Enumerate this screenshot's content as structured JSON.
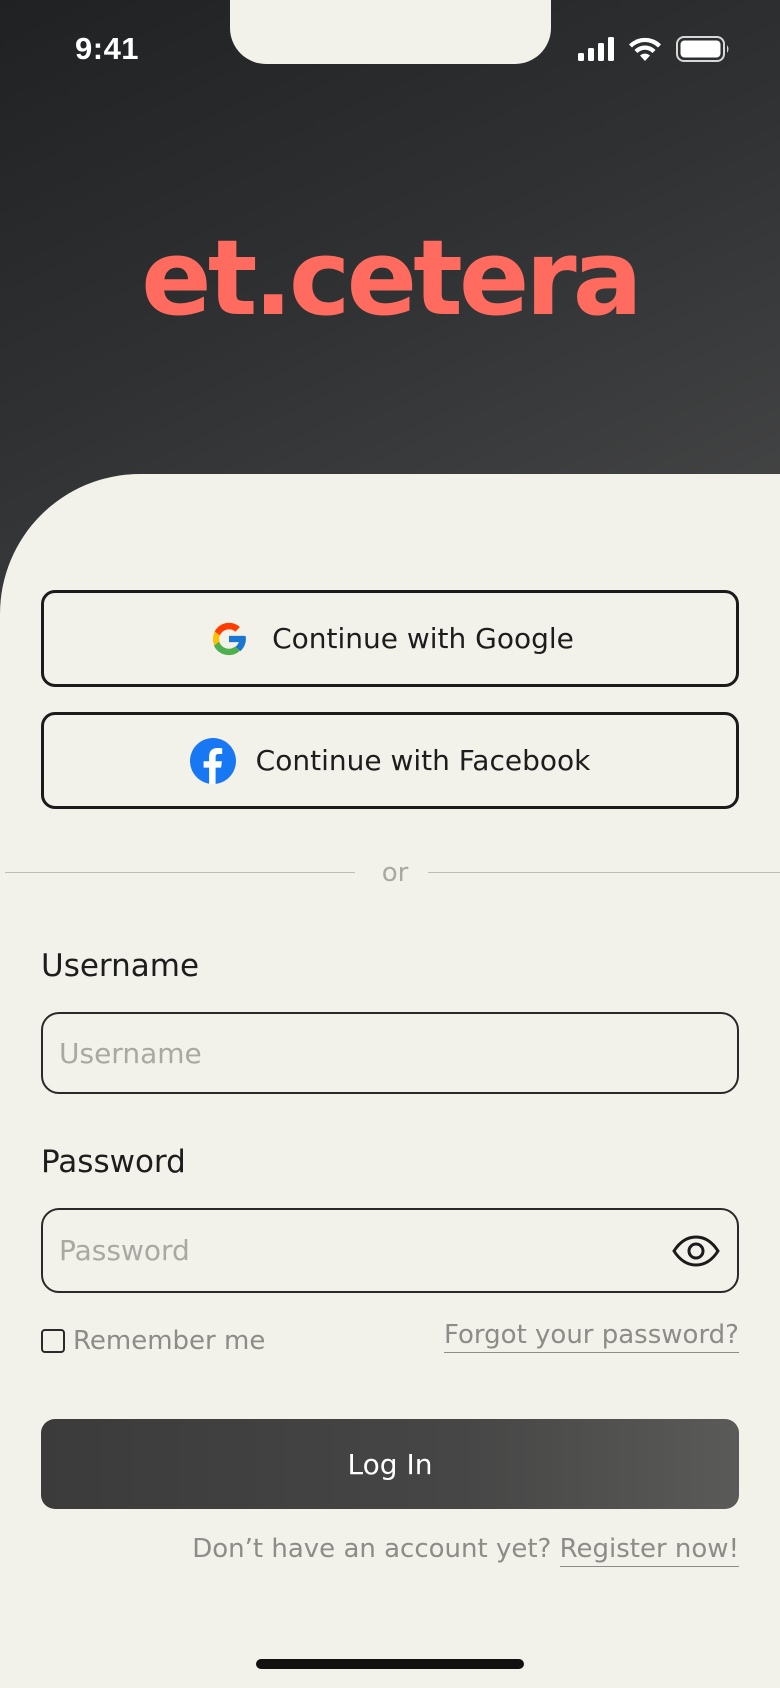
{
  "status_bar": {
    "time": "9:41",
    "icons": [
      "signal-icon",
      "wifi-icon",
      "battery-icon"
    ]
  },
  "brand": {
    "logo_text": "et.cetera",
    "logo_color": "#ff6b5e"
  },
  "social": {
    "google_label": "Continue with Google",
    "facebook_label": "Continue with Facebook",
    "google_icon": "google-icon",
    "facebook_icon": "facebook-icon"
  },
  "divider": {
    "text": "or"
  },
  "form": {
    "username": {
      "label": "Username",
      "placeholder": "Username",
      "value": ""
    },
    "password": {
      "label": "Password",
      "placeholder": "Password",
      "value": "",
      "toggle_icon": "eye-icon"
    },
    "remember_label": "Remember me",
    "remember_checked": false,
    "forgot_label": "Forgot your password?",
    "submit_label": "Log In"
  },
  "footer": {
    "prompt": "Don’t have an account yet?",
    "register_label": "Register now!"
  },
  "colors": {
    "background": "#f2f1ea",
    "header_dark": "#2f3133",
    "accent": "#ff6b5e",
    "button_dark": "#464646",
    "muted_text": "#8c8c88"
  }
}
